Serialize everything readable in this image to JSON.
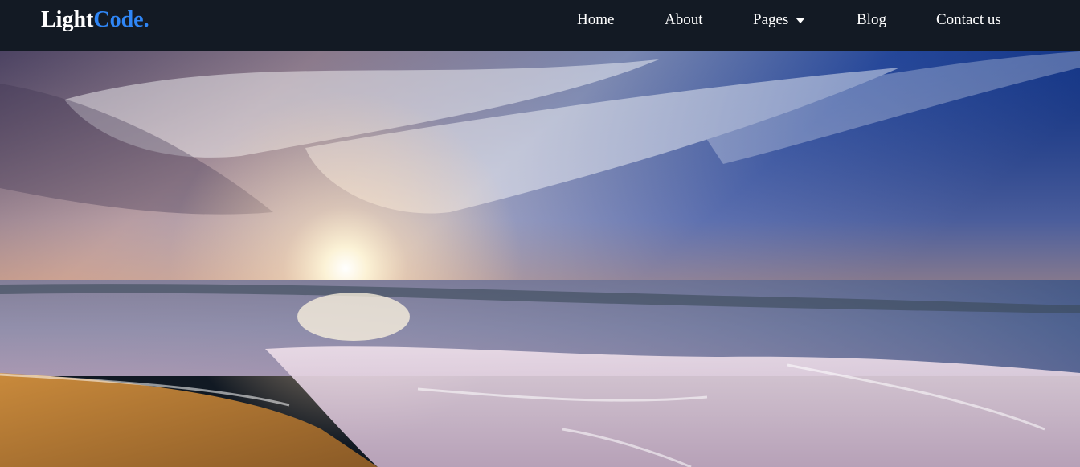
{
  "brand": {
    "part1": "Light",
    "part2": "Code."
  },
  "nav": {
    "home": "Home",
    "about": "About",
    "pages": "Pages",
    "blog": "Blog",
    "contact": "Contact us"
  },
  "colors": {
    "navbar_bg": "#131a24",
    "brand_accent": "#2f86f6",
    "nav_text": "#ffffff"
  },
  "icons": {
    "pages_dropdown": "caret-down-icon"
  },
  "hero": {
    "scene": "beach-sunset-image"
  }
}
